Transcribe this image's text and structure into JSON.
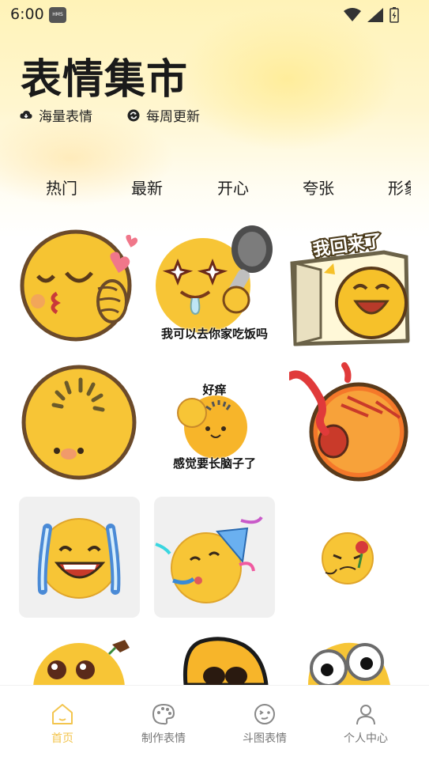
{
  "status_bar": {
    "time": "6:00",
    "hms_badge": "HMS"
  },
  "header": {
    "title": "表情集市",
    "features": [
      {
        "icon": "cloud-download-icon",
        "label": "海量表情"
      },
      {
        "icon": "refresh-icon",
        "label": "每周更新"
      }
    ]
  },
  "tabs": [
    {
      "label": "热门",
      "active": false
    },
    {
      "label": "最新",
      "active": true
    },
    {
      "label": "开心",
      "active": false
    },
    {
      "label": "夸张",
      "active": false
    },
    {
      "label": "形象",
      "active": false
    }
  ],
  "grid": {
    "captions": {
      "eat": "我可以去你家吃饭吗",
      "itch_top": "好痒",
      "itch_bottom": "感觉要长脑子了"
    },
    "stickers": [
      "kissing-face-sticker",
      "drooling-spoon-sticker",
      "im-back-sticker",
      "blank-face-sticker",
      "itchy-head-sticker",
      "crying-red-face-sticker",
      "tears-of-joy-sticker",
      "party-face-sticker",
      "rose-face-sticker",
      "cute-eyes-sticker",
      "dark-face-sticker",
      "googly-eyes-sticker"
    ],
    "im_back_text": "我回来了"
  },
  "bottom_nav": [
    {
      "icon": "home-icon",
      "label": "首页",
      "active": true
    },
    {
      "icon": "palette-icon",
      "label": "制作表情",
      "active": false
    },
    {
      "icon": "smiley-icon",
      "label": "斗图表情",
      "active": false
    },
    {
      "icon": "person-icon",
      "label": "个人中心",
      "active": false
    }
  ],
  "colors": {
    "accent": "#f3c54e",
    "tab_highlight": "#c6b6ff"
  }
}
